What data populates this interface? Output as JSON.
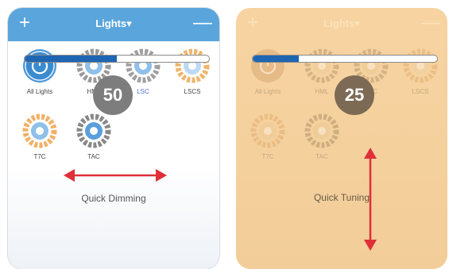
{
  "colors": {
    "header_blue": "#5aa5dc",
    "tuning_panel": "#f6d3a1",
    "level_fill": "#1f66b2",
    "arrow_red": "#e02f38"
  },
  "left_panel": {
    "header": {
      "title": "Lights▾",
      "add": "+",
      "remove": "—"
    },
    "level": 0.5,
    "bubble_value": "50",
    "lights": [
      {
        "label": "All Lights",
        "icon": "power-icon"
      },
      {
        "label": "HML",
        "icon": "light-dial-icon"
      },
      {
        "label": "LSC",
        "icon": "light-dial-icon"
      },
      {
        "label": "LSCS",
        "icon": "light-dial-icon"
      },
      {
        "label": "T7C",
        "icon": "light-dial-icon"
      },
      {
        "label": "TAC",
        "icon": "light-dial-icon"
      }
    ],
    "caption": "Quick Dimming"
  },
  "right_panel": {
    "header": {
      "title": "Lights▾",
      "add": "+",
      "remove": "—"
    },
    "level": 0.25,
    "bubble_value": "25",
    "lights": [
      {
        "label": "All Lights"
      },
      {
        "label": "HML"
      },
      {
        "label": "LSC"
      },
      {
        "label": "LSCS"
      },
      {
        "label": "T7C"
      },
      {
        "label": "TAC"
      }
    ],
    "caption": "Quick Tuning"
  }
}
